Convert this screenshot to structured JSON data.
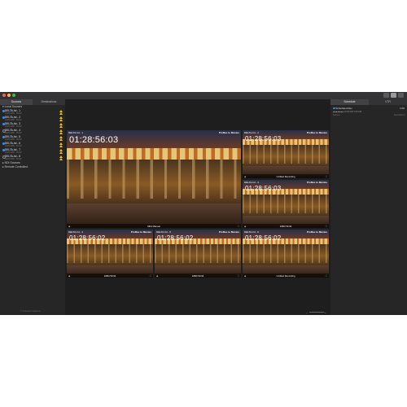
{
  "titlebar": {
    "view_icons": [
      "view-single-icon",
      "view-grid-icon",
      "view-list-icon"
    ]
  },
  "left": {
    "tabs": [
      "Sources",
      "Destinations"
    ],
    "local_sources_label": "Local Sources",
    "sources": [
      {
        "name": "DELTA-hd - 1",
        "sub": "1920x1080 · 59.94i",
        "checked": true
      },
      {
        "name": "DELTA-hd - 2",
        "sub": "1920x1080 · 59.94i",
        "checked": true
      },
      {
        "name": "DELTA-hd - 3",
        "sub": "1920x1080 · 59.94i",
        "checked": true
      },
      {
        "name": "DELTA-hd - 4",
        "sub": "1920x1080 · 59.94i",
        "checked": false
      },
      {
        "name": "DELTA-hd - 5",
        "sub": "1920x1080 · 59.94i",
        "checked": true
      },
      {
        "name": "DELTA-hd - 6",
        "sub": "1920x1080 · 59.94i",
        "checked": true
      },
      {
        "name": "DELTA-hd - 7",
        "sub": "1920x1080 · 59.94i",
        "checked": true
      },
      {
        "name": "DELTA-hd - 8",
        "sub": "1920x1080 · 59.94i",
        "checked": false
      }
    ],
    "ndi_sources_label": "NDI Sources",
    "remote_label": "Remote Controlled",
    "footer": "© Deltacast Solutions"
  },
  "main": {
    "tiles": [
      {
        "name": "DELTA-hd - 1",
        "mode": "ProRes to Movies",
        "timecode": "01:28:56:03",
        "footer": "MFA Manual"
      },
      {
        "name": "DELTA-hd - 2",
        "mode": "ProRes to Movies",
        "timecode": "01:28:56:03",
        "footer": "Untitled Recording"
      },
      {
        "name": "DELTA-hd - 3",
        "mode": "ProRes to Movies",
        "timecode": "01:28:56:03",
        "footer": "1080i 59.94"
      },
      {
        "name": "DELTA-hd - 4",
        "mode": "ProRes to Movies",
        "timecode": "01:28:56:02",
        "footer": "1080i 59.94"
      },
      {
        "name": "DELTA-hd - 5",
        "mode": "ProRes to Movies",
        "timecode": "01:28:56:02",
        "footer": "1080i 59.94"
      },
      {
        "name": "DELTA-hd - 6",
        "mode": "ProRes to Movies",
        "timecode": "01:28:56:02",
        "footer": "Untitled Recording"
      }
    ]
  },
  "right": {
    "tabs": [
      "Schedule",
      "VTR"
    ],
    "schedule_title": "Scheduled Rec",
    "schedule_right": "1:00",
    "schedule_dots": "●●●●●●●",
    "schedule_time1": "10:00 AM",
    "schedule_time2": "1:00 AM",
    "col1": "Sources",
    "col2": "Destinations"
  }
}
